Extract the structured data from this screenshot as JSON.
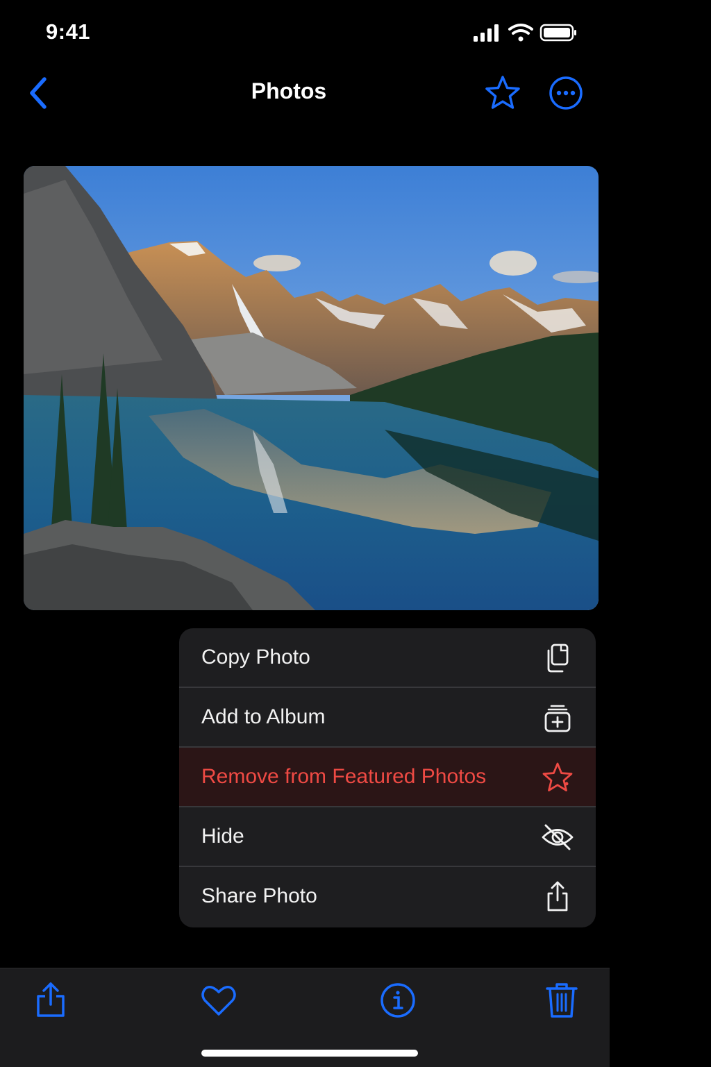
{
  "status_bar": {
    "time": "9:41"
  },
  "nav": {
    "title": "Photos",
    "back_icon": "chevron-left-icon",
    "favorite_icon": "star-outline-icon",
    "more_icon": "ellipsis-circle-icon"
  },
  "photo": {
    "subject": "mountain-lake-landscape"
  },
  "context_menu": {
    "items": [
      {
        "label": "Copy Photo",
        "icon": "copy-icon"
      },
      {
        "label": "Add to Album",
        "icon": "add-to-album-icon"
      },
      {
        "label": "Remove from Featured Photos",
        "icon": "star-remove-icon",
        "destructive": true
      },
      {
        "label": "Hide",
        "icon": "eye-slash-icon"
      },
      {
        "label": "Share Photo",
        "icon": "share-icon"
      }
    ]
  },
  "toolbar": {
    "items": [
      {
        "icon": "share-icon"
      },
      {
        "icon": "heart-icon"
      },
      {
        "icon": "info-icon"
      },
      {
        "icon": "trash-icon"
      }
    ]
  },
  "colors": {
    "accent": "#1a6cff",
    "destructive": "#ef4a44",
    "menu_background": "#1e1e20",
    "toolbar_background": "#1c1c1e"
  }
}
